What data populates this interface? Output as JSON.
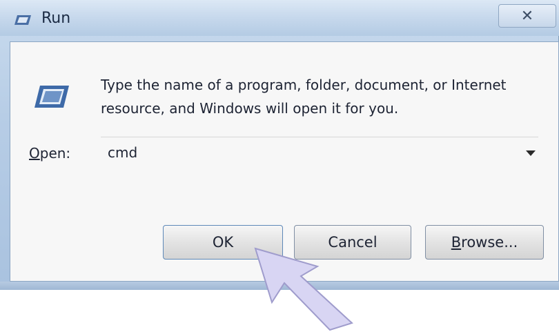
{
  "window": {
    "title": "Run",
    "close_glyph": "✕",
    "icons": {
      "title_icon": "run-icon",
      "dialog_icon": "run-icon"
    }
  },
  "dialog": {
    "instruction": "Type the name of a program, folder, document, or Internet resource, and Windows will open it for you.",
    "open_label_accesskey": "O",
    "open_label_rest": "pen:",
    "open_value": "cmd"
  },
  "buttons": {
    "ok": "OK",
    "cancel": "Cancel",
    "browse_accesskey": "B",
    "browse_rest": "rowse..."
  },
  "colors": {
    "frame": "#b7cde6",
    "accent_arrow": "#c9c6ef"
  }
}
